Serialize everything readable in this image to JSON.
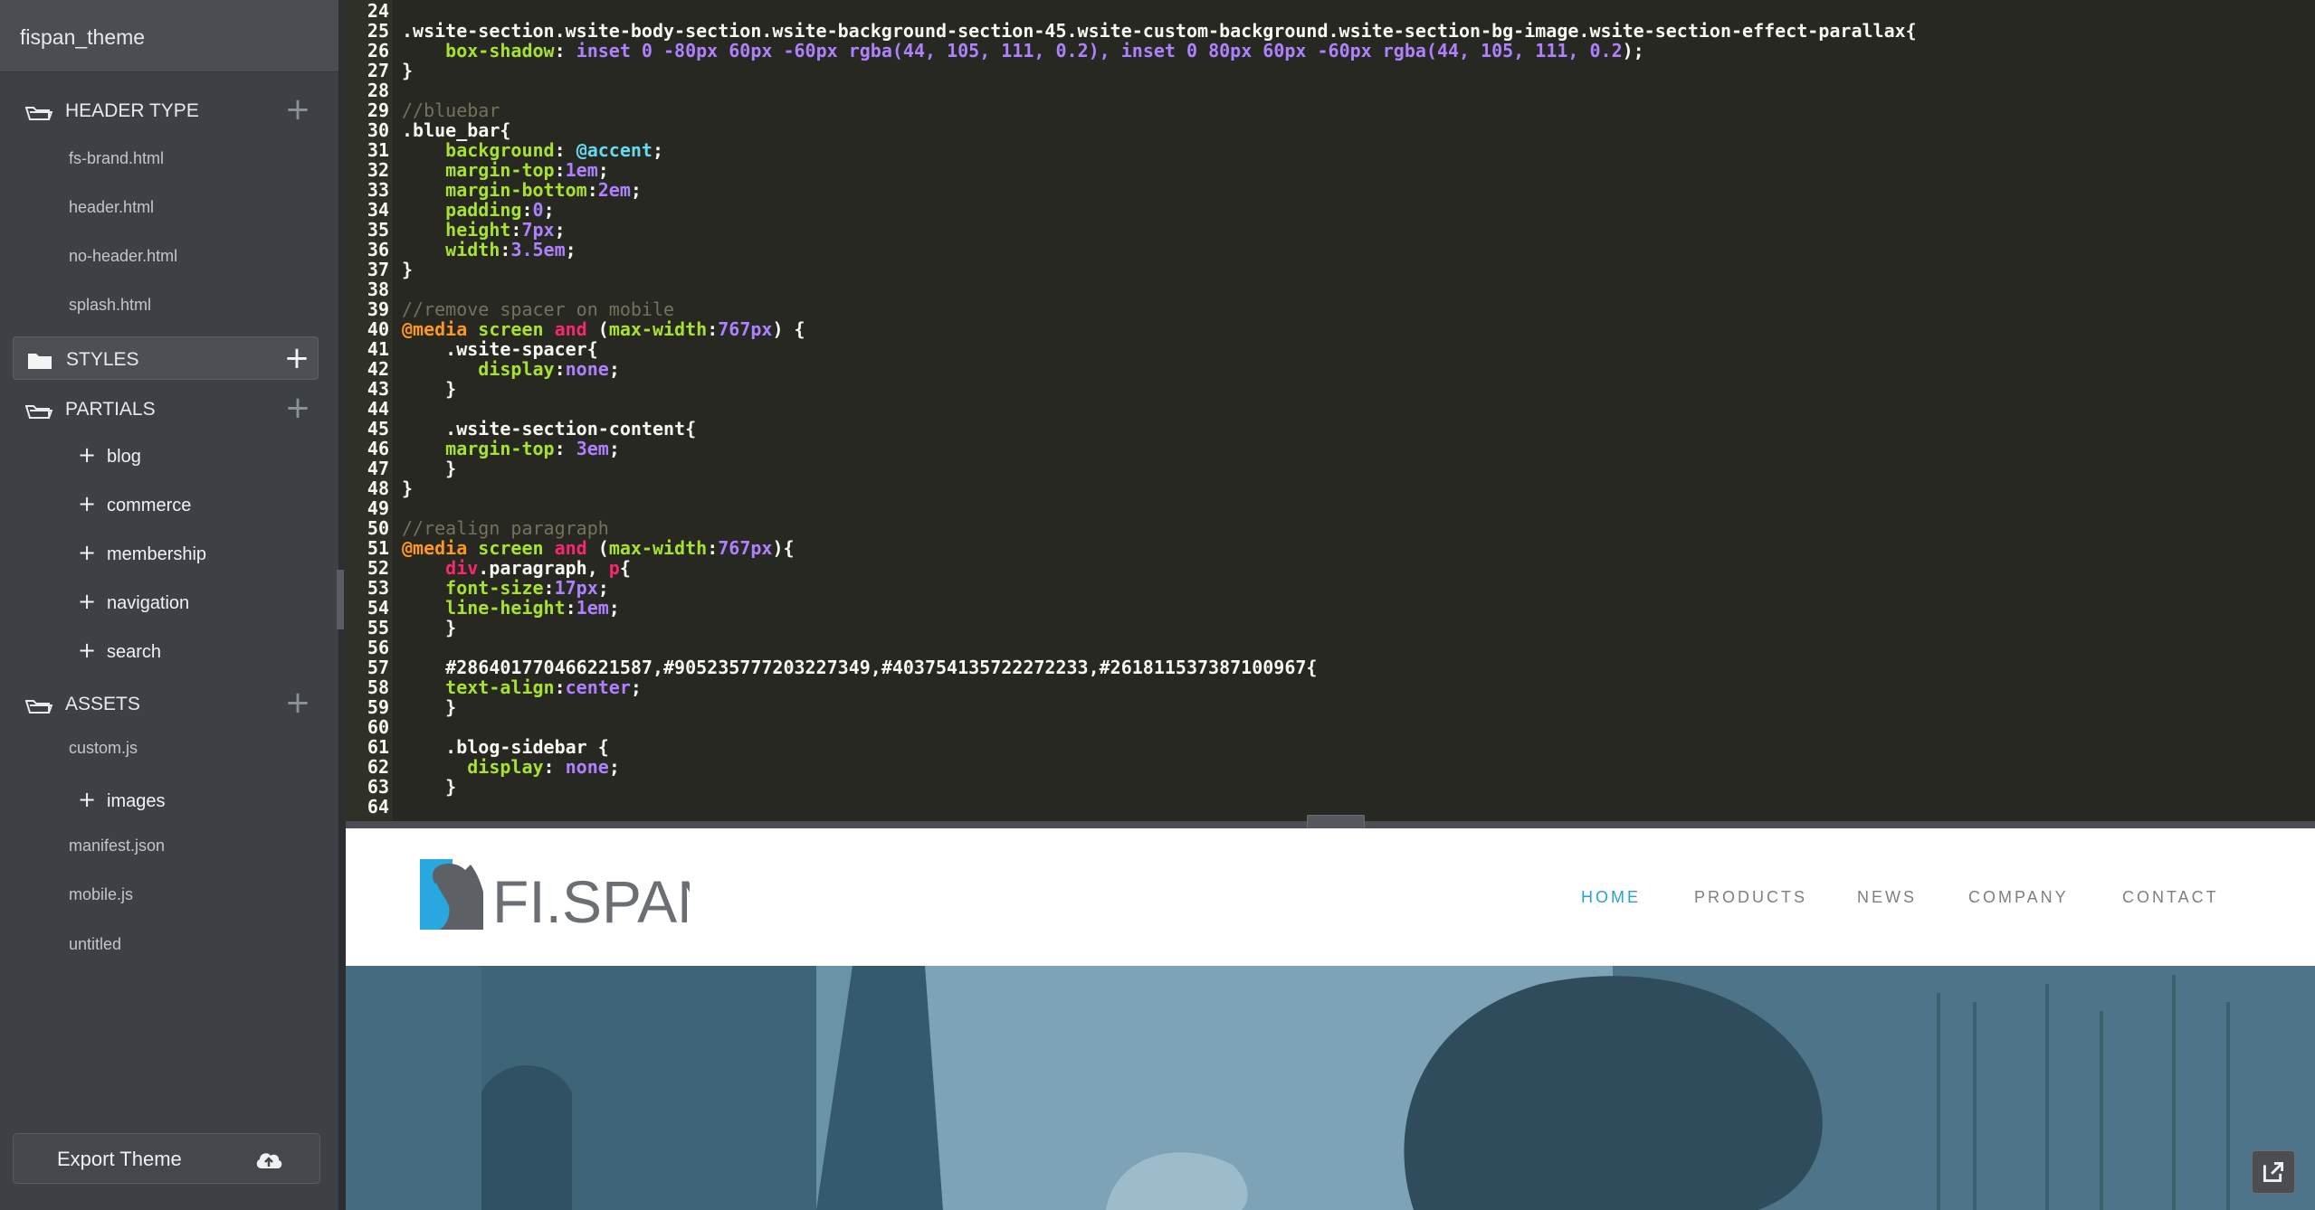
{
  "sidebar": {
    "title": "fispan_theme",
    "sections": [
      {
        "label": "HEADER TYPE",
        "items": [
          "fs-brand.html",
          "header.html",
          "no-header.html",
          "splash.html"
        ]
      },
      {
        "label": "STYLES",
        "items": []
      },
      {
        "label": "PARTIALS",
        "items": [
          "blog",
          "commerce",
          "membership",
          "navigation",
          "search"
        ]
      },
      {
        "label": "ASSETS",
        "files": [
          "custom.js",
          "manifest.json",
          "mobile.js",
          "untitled"
        ],
        "folders": [
          "images"
        ]
      }
    ],
    "export_label": "Export Theme"
  },
  "editor": {
    "line_numbers": [
      "24",
      "25",
      "26",
      "27",
      "28",
      "29",
      "30",
      "31",
      "32",
      "33",
      "34",
      "35",
      "36",
      "37",
      "38",
      "39",
      "40",
      "41",
      "42",
      "43",
      "44",
      "45",
      "46",
      "47",
      "48",
      "49",
      "50",
      "51",
      "52",
      "53",
      "54",
      "55",
      "56",
      "57",
      "58",
      "59",
      "60",
      "61",
      "62",
      "63",
      "64"
    ],
    "lines": {
      "l25": ".wsite-section.wsite-body-section.wsite-background-section-45.wsite-custom-background.wsite-section-bg-image.wsite-section-effect-parallax{",
      "l26_prop": "box-shadow",
      "l26_v1": "inset 0 -80px 60px -60px rgba(",
      "l26_n1": "44, 105, 111, 0.2",
      "l26_v2": "), inset 0 80px 60px -60px rgba(",
      "l26_n2": "44, 105, 111, 0.2",
      "l29": "//bluebar",
      "l30": ".blue_bar{",
      "l31_prop": "background",
      "l31_val": "@accent",
      "l32_prop": "margin-top",
      "l32_val": "1em",
      "l33_prop": "margin-bottom",
      "l33_val": "2em",
      "l34_prop": "padding",
      "l34_val": "0",
      "l35_prop": "height",
      "l35_val": "7px",
      "l36_prop": "width",
      "l36_val": "3.5em",
      "l39": "//remove spacer on mobile",
      "l40_at": "@media",
      "l40_kw1": "screen",
      "l40_kw2": "and",
      "l40_prop": "max-width",
      "l40_val": "767px",
      "l41": ".wsite-spacer{",
      "l42_prop": "display",
      "l42_val": "none",
      "l45": ".wsite-section-content{",
      "l46_prop": "margin-top",
      "l46_val": "3em",
      "l50": "//realign paragraph",
      "l51_at": "@media",
      "l51_kw1": "screen",
      "l51_kw2": "and",
      "l51_prop": "max-width",
      "l51_val": "767px",
      "l52_tag": "div",
      "l52_rest": ".paragraph, ",
      "l52_tag2": "p",
      "l53_prop": "font-size",
      "l53_val": "17px",
      "l54_prop": "line-height",
      "l54_val": "1em",
      "l57": "#286401770466221587,#905235777203227349,#403754135722272233,#261811537387100967{",
      "l58_prop": "text-align",
      "l58_val": "center",
      "l61": ".blog-sidebar {",
      "l62_prop": "display",
      "l62_val": "none"
    }
  },
  "preview": {
    "logo_text": "FI.SPAN",
    "nav": [
      "HOME",
      "PRODUCTS",
      "NEWS",
      "COMPANY",
      "CONTACT"
    ],
    "active_nav": "HOME",
    "colors": {
      "accent": "#2a9fd6",
      "logo_blue": "#29a8e0",
      "logo_gray": "#5d6166"
    }
  },
  "icons": [
    "folder-icon",
    "plus-icon",
    "cloud-upload-icon",
    "popout-icon"
  ]
}
